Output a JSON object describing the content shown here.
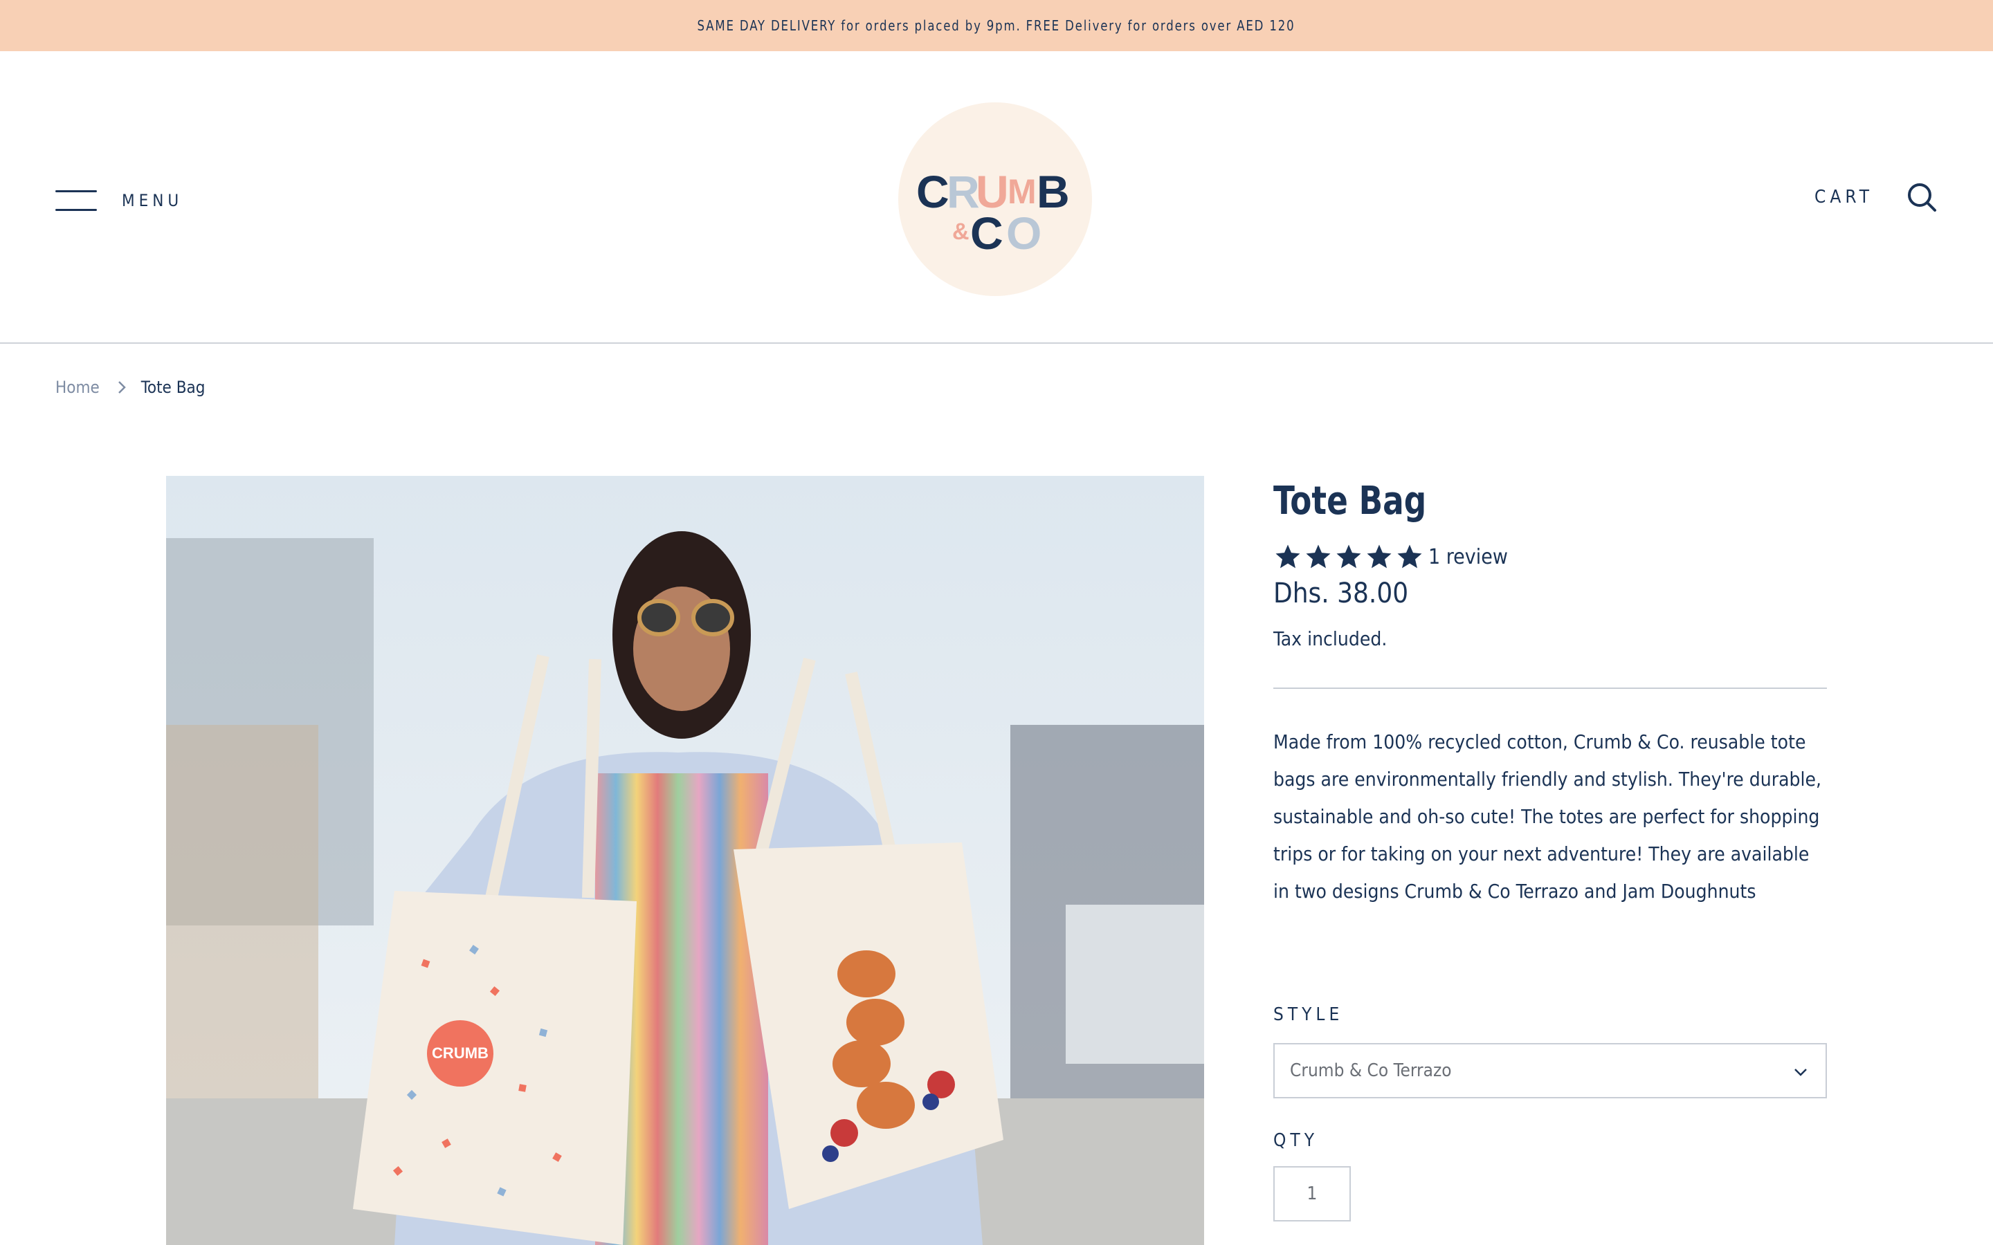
{
  "announcement": "SAME DAY DELIVERY for orders placed by 9pm. FREE Delivery for orders over AED 120",
  "header": {
    "menu_label": "MENU",
    "logo_text": "Crumb & Co",
    "cart_label": "CART"
  },
  "icons": {
    "menu": "hamburger-icon",
    "search": "search-icon",
    "breadcrumb_separator": "chevron-right-icon",
    "select_arrow": "chevron-down-icon",
    "rating": "star-icon"
  },
  "breadcrumb": {
    "home": "Home",
    "current": "Tote Bag"
  },
  "product": {
    "title": "Tote Bag",
    "rating_stars": 5,
    "review_count": "1 review",
    "price": "Dhs. 38.00",
    "tax_note": "Tax included.",
    "description": "Made from 100% recycled cotton, Crumb & Co. reusable tote bags are environmentally friendly and stylish. They're durable, sustainable and oh-so cute! The totes are perfect for shopping trips or for taking on your next adventure! They are available in two designs Crumb & Co Terrazo and Jam Doughnuts",
    "style_label": "STYLE",
    "style_selected": "Crumb & Co Terrazo",
    "qty_label": "QTY",
    "qty_value": "1"
  },
  "colors": {
    "announcement_bg": "#f8d0b5",
    "primary_navy": "#1b3355",
    "logo_bg": "#fbf1e7",
    "logo_pink": "#f0a898",
    "logo_blue": "#b9c7d6"
  }
}
